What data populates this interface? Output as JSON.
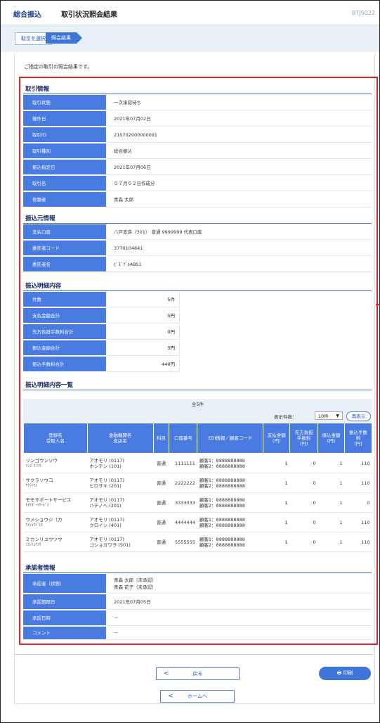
{
  "header": {
    "title_a": "総合振込",
    "title_b": "取引状況照会結果",
    "screen_code": "BTJS022"
  },
  "breadcrumb": [
    "取引を選択",
    "照会結果"
  ],
  "intro": "ご指定の取引の照会結果です。",
  "torihiki": {
    "heading": "取引情報",
    "rows": [
      {
        "k": "取引状態",
        "v": "一次承認待ち"
      },
      {
        "k": "操作日",
        "v": "2021年07月02日"
      },
      {
        "k": "取引ID",
        "v": "210702000000091"
      },
      {
        "k": "取引種別",
        "v": "総合振込"
      },
      {
        "k": "振込指定日",
        "v": "2021年07月06日"
      },
      {
        "k": "取引名",
        "v": "０７月０２日作成分"
      },
      {
        "k": "依頼者",
        "v": "青森 太郎"
      }
    ]
  },
  "furikomimoto": {
    "heading": "振込元情報",
    "rows": [
      {
        "k": "支払口座",
        "v": "八戸支店（301） 普通 9999999 代表口座"
      },
      {
        "k": "委託者コード",
        "v": "3770104841"
      },
      {
        "k": "委託者名",
        "v": "ﾋﾞｽﾞﾌﾞﾙABS1"
      }
    ]
  },
  "meisai": {
    "heading": "振込明細内容",
    "rows": [
      {
        "k": "件数",
        "v": "5件"
      },
      {
        "k": "支払金額合計",
        "v": "5円"
      },
      {
        "k": "先方負担手数料合計",
        "v": "0円"
      },
      {
        "k": "振込金額合計",
        "v": "5円"
      },
      {
        "k": "振込手数料合計",
        "v": "440円"
      }
    ]
  },
  "ichiran": {
    "heading": "振込明細内容一覧",
    "total": "全5件",
    "display_label": "表示件数：",
    "display_value": "10件",
    "redisplay": "再表示",
    "headers": [
      "登録名\n受取人名",
      "金融機関名\n支店名",
      "科目",
      "口座番号",
      "EDI情報／顧客コード",
      "支払金額\n(円)",
      "先方負担\n手数料\n(円)",
      "振込金額\n(円)",
      "振込手数\n料\n(円)"
    ],
    "rows": [
      {
        "name": "リンゴウンソウ",
        "kana": "ﾘﾝｺﾞｳﾝｿｳ",
        "bank": "アオモリ (0117)",
        "branch": "ホンテン (101)",
        "kamoku": "普通",
        "acct": "1111111",
        "edi1": "顧客1：8888888888",
        "edi2": "顧客2：8888888888",
        "pay": "1",
        "fee": "0",
        "amt": "1",
        "tf": "110"
      },
      {
        "name": "サクラソウコ",
        "kana": "ｻｸﾗｿｳｺ",
        "bank": "アオモリ (0117)",
        "branch": "ヒロサキ (201)",
        "kamoku": "普通",
        "acct": "2222222",
        "edi1": "顧客1：8888888888",
        "edi2": "顧客2：8888888888",
        "pay": "1",
        "fee": "0",
        "amt": "1",
        "tf": "110"
      },
      {
        "name": "モモサポートサービス",
        "kana": "ﾓﾓｻﾎﾟｰﾄｻｰﾋﾞｽ",
        "bank": "アオモリ (0117)",
        "branch": "ハチノヘ (301)",
        "kamoku": "普通",
        "acct": "3333333",
        "edi1": "顧客1：8888888888",
        "edi2": "顧客2：8888888888",
        "pay": "1",
        "fee": "0",
        "amt": "1",
        "tf": "0"
      },
      {
        "name": "ウメショウジ（カ",
        "kana": "ｳﾒｼｮｳｼﾞ(ｶ",
        "bank": "アオモリ (0117)",
        "branch": "クロイシ (401)",
        "kamoku": "普通",
        "acct": "4444444",
        "edi1": "顧客1：8888888888",
        "edi2": "顧客2：8888888888",
        "pay": "1",
        "fee": "0",
        "amt": "1",
        "tf": "110"
      },
      {
        "name": "ミカンリユウツウ",
        "kana": "ﾐｶﾝﾘｭｳﾂｳ",
        "bank": "アオモリ (0117)",
        "branch": "ゴショガワラ (501)",
        "kamoku": "普通",
        "acct": "5555555",
        "edi1": "顧客1：8888888888",
        "edi2": "顧客2：8888888888",
        "pay": "1",
        "fee": "0",
        "amt": "1",
        "tf": "110"
      }
    ]
  },
  "shonin": {
    "heading": "承認者情報",
    "approver_label": "承認者（状態）",
    "approver_line1": "青森 太郎（未承認）",
    "approver_line2": "青森 花子（未承認）",
    "rows": [
      {
        "k": "承認期限日",
        "v": "2021年07月05日"
      },
      {
        "k": "承認日時",
        "v": "－"
      },
      {
        "k": "コメント",
        "v": "－"
      }
    ]
  },
  "buttons": {
    "back": "戻る",
    "print": "印刷",
    "home": "ホームへ"
  },
  "colors": {
    "accent": "#4a7be0",
    "highlight": "#e3212d",
    "heading": "#1c2e6b"
  }
}
